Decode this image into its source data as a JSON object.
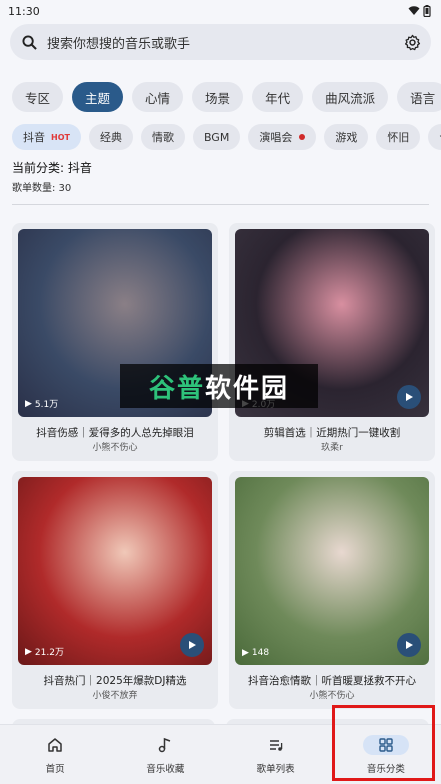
{
  "status": {
    "time": "11:30"
  },
  "search": {
    "placeholder": "搜索你想搜的音乐或歌手"
  },
  "categories": [
    "专区",
    "主题",
    "心情",
    "场景",
    "年代",
    "曲风流派",
    "语言"
  ],
  "active_category": "主题",
  "tags": [
    {
      "label": "抖音",
      "badge": "HOT"
    },
    {
      "label": "经典"
    },
    {
      "label": "情歌"
    },
    {
      "label": "BGM"
    },
    {
      "label": "演唱会"
    },
    {
      "label": "游戏"
    },
    {
      "label": "怀旧"
    },
    {
      "label": "合"
    }
  ],
  "info": {
    "current_category": "当前分类: 抖音",
    "playlist_count": "歌单数量: 30"
  },
  "playlists": [
    {
      "title": "抖音伤感｜爱得多的人总先掉眼泪",
      "author": "小熊不伤心",
      "plays": "5.1万",
      "colors": [
        "#3a4a66",
        "#8a7f86",
        "#2a3048"
      ]
    },
    {
      "title": "剪辑首选｜近期热门一键收割",
      "author": "玖柔r",
      "plays": "2.0万",
      "colors": [
        "#2b2430",
        "#d88fa0",
        "#3a3440"
      ]
    },
    {
      "title": "抖音热门｜2025年爆款DJ精选",
      "author": "小俊不放弃",
      "plays": "21.2万",
      "colors": [
        "#b02a2a",
        "#f0c8b8",
        "#6a1818"
      ]
    },
    {
      "title": "抖音治愈情歌｜听首暖夏拯救不开心",
      "author": "小熊不伤心",
      "plays": "148",
      "colors": [
        "#6f8a5a",
        "#e8d8d0",
        "#4a6a3a"
      ]
    }
  ],
  "watermark": {
    "part1": "谷普",
    "part2": "软件园"
  },
  "bottom_nav": [
    "首页",
    "音乐收藏",
    "歌单列表",
    "音乐分类"
  ],
  "accent": "#2a5a8a"
}
